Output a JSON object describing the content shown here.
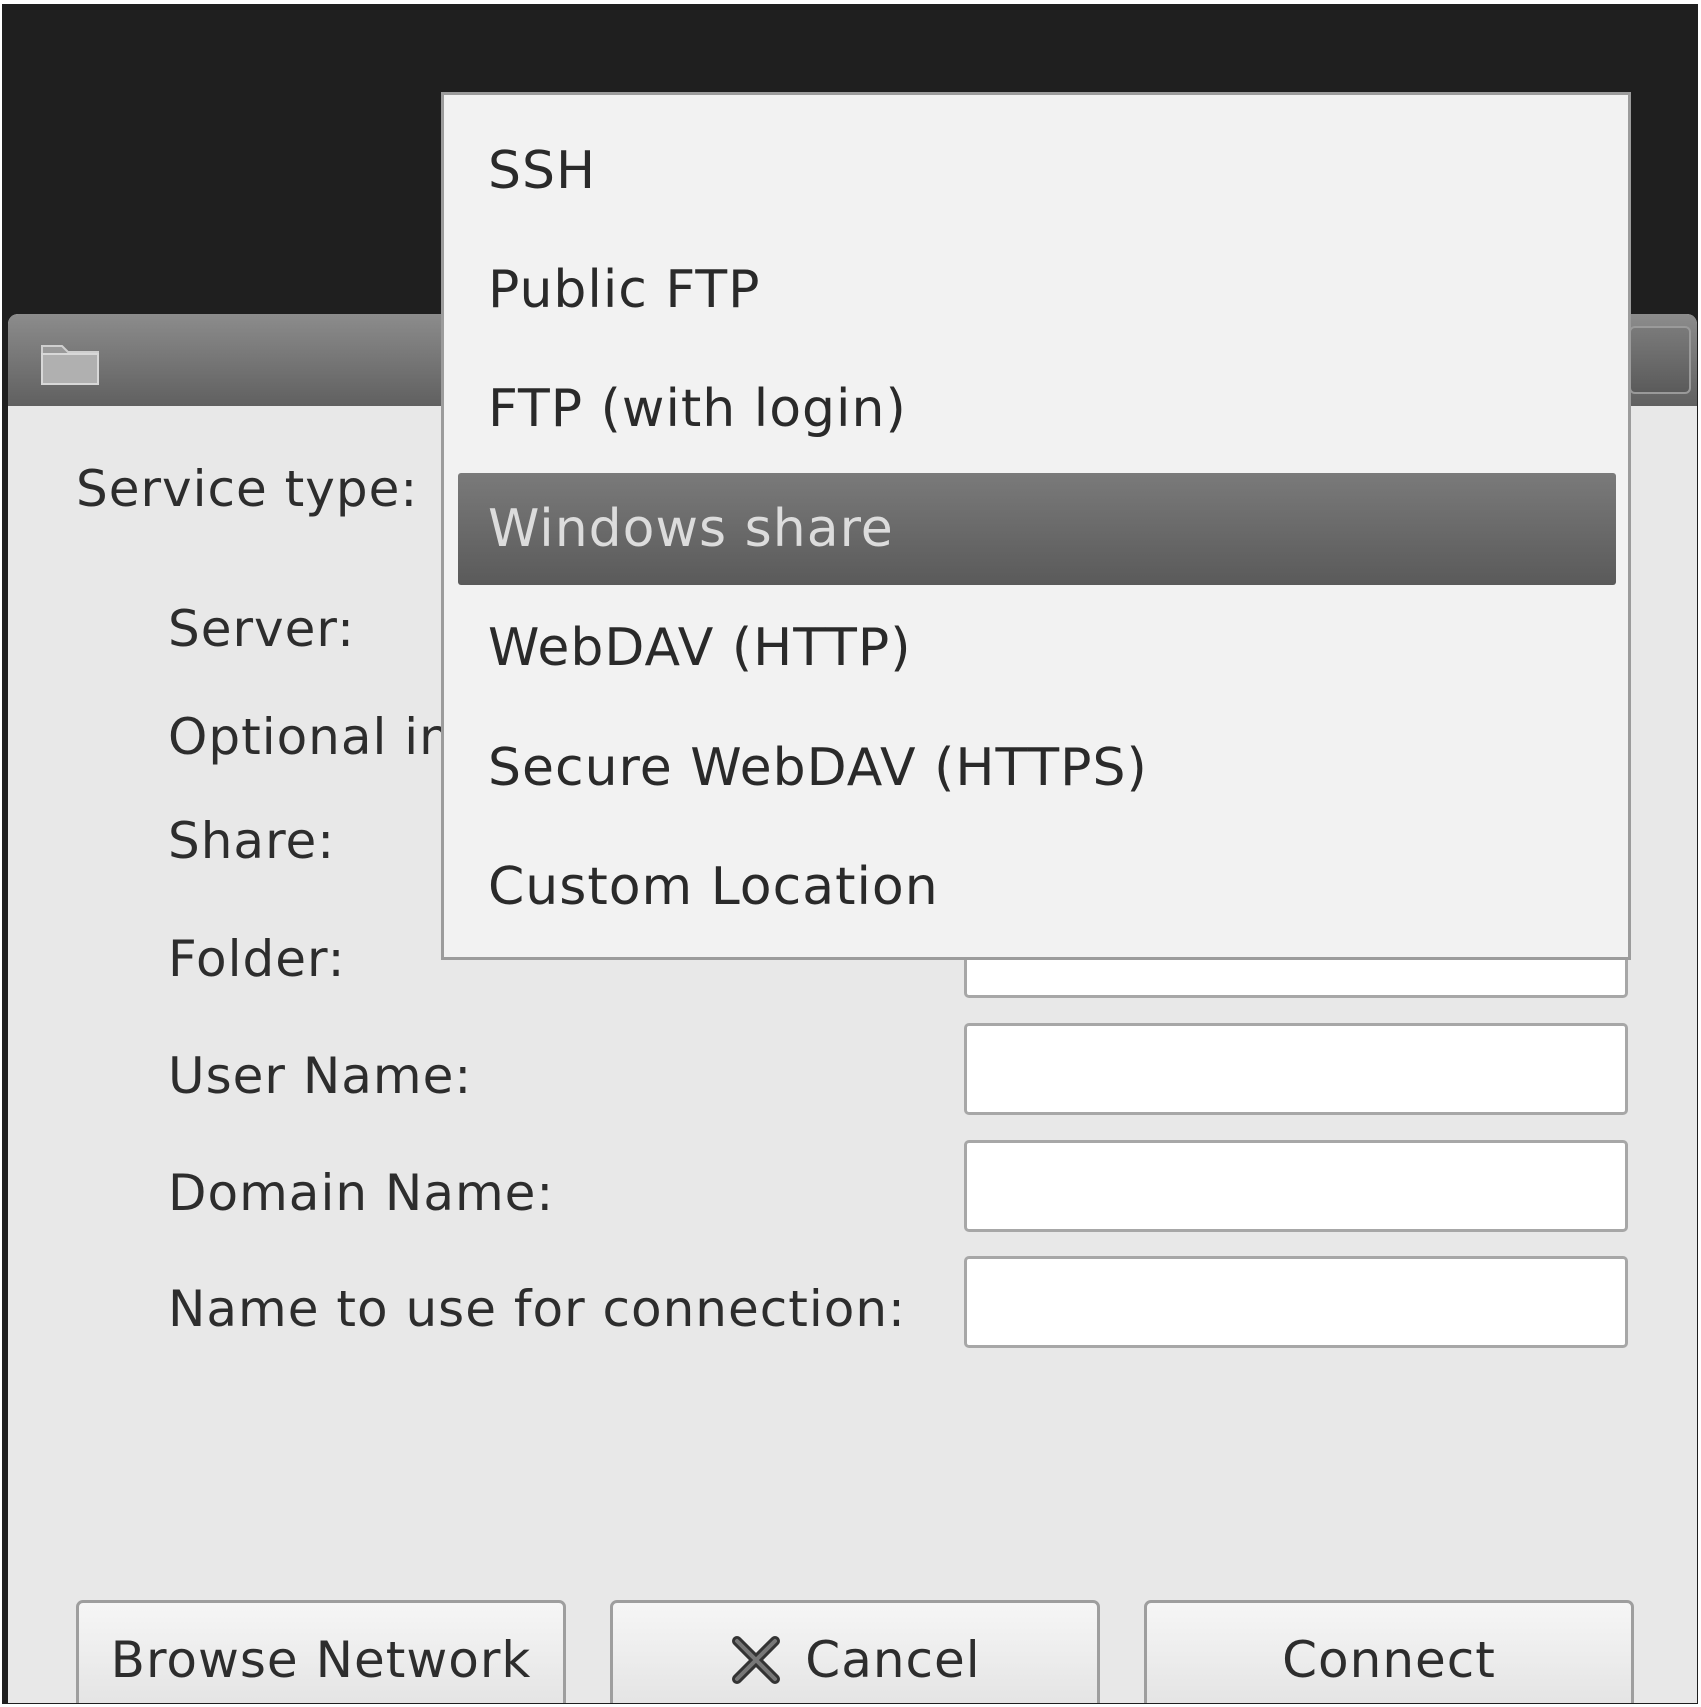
{
  "dialog": {
    "labels": {
      "service_type": "Service type:",
      "server": "Server:",
      "optional_info": "Optional in",
      "share": "Share:",
      "folder": "Folder:",
      "user_name": "User Name:",
      "domain_name": "Domain Name:",
      "connection_name": "Name to use for connection:"
    },
    "fields": {
      "folder": "",
      "user_name": "",
      "domain_name": "",
      "connection_name": ""
    },
    "buttons": {
      "browse": "Browse Network",
      "cancel": "Cancel",
      "connect": "Connect"
    }
  },
  "service_menu": {
    "selected": "Windows share",
    "items": [
      "SSH",
      "Public FTP",
      "FTP (with login)",
      "Windows share",
      "WebDAV (HTTP)",
      "Secure WebDAV (HTTPS)",
      "Custom Location"
    ]
  }
}
